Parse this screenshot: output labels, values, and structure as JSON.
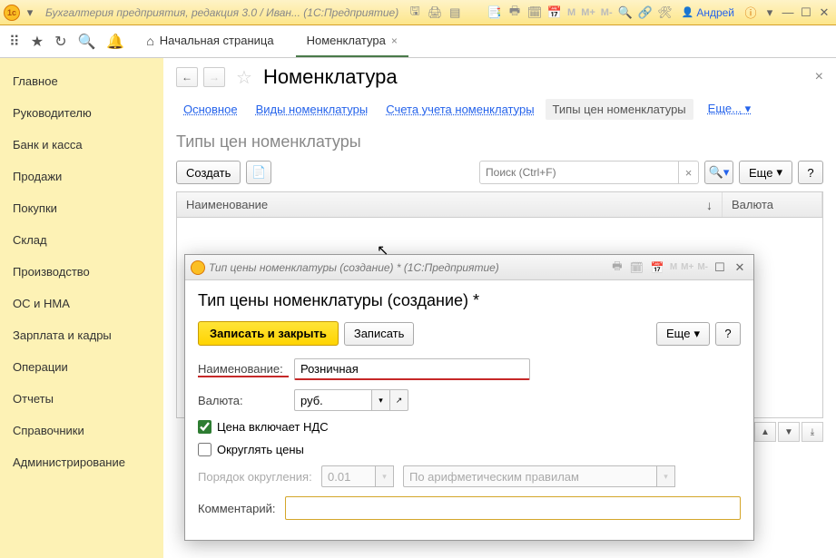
{
  "titlebar": {
    "title": "Бухгалтерия предприятия, редакция 3.0 / Иван...   (1С:Предприятие)",
    "user": "Андрей"
  },
  "tabs": {
    "home": "Начальная страница",
    "current": "Номенклатура"
  },
  "sidebar": {
    "items": [
      "Главное",
      "Руководителю",
      "Банк и касса",
      "Продажи",
      "Покупки",
      "Склад",
      "Производство",
      "ОС и НМА",
      "Зарплата и кадры",
      "Операции",
      "Отчеты",
      "Справочники",
      "Администрирование"
    ]
  },
  "page": {
    "title": "Номенклатура",
    "subnav": {
      "main": "Основное",
      "kinds": "Виды номенклатуры",
      "accounts": "Счета учета номенклатуры",
      "price_types": "Типы цен номенклатуры",
      "more": "Еще..."
    },
    "section_title": "Типы цен номенклатуры",
    "create_btn": "Создать",
    "search_placeholder": "Поиск (Ctrl+F)",
    "more_btn": "Еще",
    "help_btn": "?",
    "cols": {
      "name": "Наименование",
      "currency": "Валюта"
    }
  },
  "dialog": {
    "window_title": "Тип цены номенклатуры (создание) *   (1С:Предприятие)",
    "header": "Тип цены номенклатуры (создание) *",
    "save_close": "Записать и закрыть",
    "save": "Записать",
    "more": "Еще",
    "help": "?",
    "name_label": "Наименование:",
    "name_value": "Розничная",
    "currency_label": "Валюта:",
    "currency_value": "руб.",
    "vat_label": "Цена включает НДС",
    "round_label": "Округлять цены",
    "round_order_label": "Порядок округления:",
    "round_order_value": "0.01",
    "round_rule_value": "По арифметическим правилам",
    "comment_label": "Комментарий:"
  }
}
